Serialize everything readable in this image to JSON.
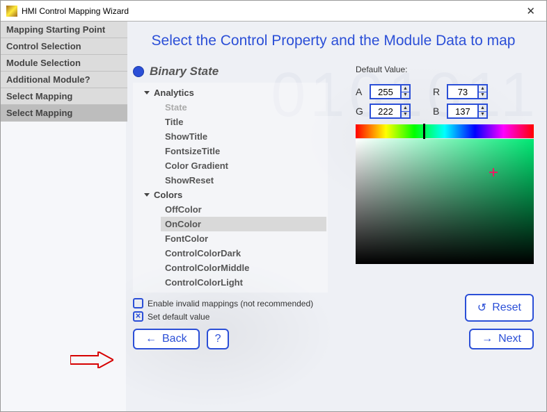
{
  "title": "HMI Control Mapping Wizard",
  "sidebar": {
    "items": [
      {
        "label": "Mapping Starting Point",
        "selected": false
      },
      {
        "label": "Control Selection",
        "selected": false
      },
      {
        "label": "Module Selection",
        "selected": false
      },
      {
        "label": "Additional Module?",
        "selected": false
      },
      {
        "label": "Select Mapping",
        "selected": false
      },
      {
        "label": "Select Mapping",
        "selected": true
      }
    ]
  },
  "heading": "Select the Control Property and the Module Data to map",
  "binary_state_label": "Binary State",
  "tree": {
    "groups": [
      {
        "label": "Analytics",
        "items": [
          {
            "label": "State",
            "dim": true
          },
          {
            "label": "Title"
          },
          {
            "label": "ShowTitle"
          },
          {
            "label": "FontsizeTitle"
          },
          {
            "label": "Color Gradient"
          },
          {
            "label": "ShowReset"
          }
        ]
      },
      {
        "label": "Colors",
        "items": [
          {
            "label": "OffColor"
          },
          {
            "label": "OnColor",
            "selected": true
          },
          {
            "label": "FontColor"
          },
          {
            "label": "ControlColorDark"
          },
          {
            "label": "ControlColorMiddle"
          },
          {
            "label": "ControlColorLight"
          }
        ]
      }
    ]
  },
  "right": {
    "default_value_label": "Default Value:",
    "argb": {
      "A": {
        "label": "A",
        "value": "255"
      },
      "R": {
        "label": "R",
        "value": "73"
      },
      "G": {
        "label": "G",
        "value": "222"
      },
      "B": {
        "label": "B",
        "value": "137"
      }
    }
  },
  "checkboxes": {
    "enable_invalid": {
      "label": "Enable invalid mappings (not recommended)",
      "checked": false
    },
    "set_default": {
      "label": "Set default value",
      "checked": true
    }
  },
  "buttons": {
    "reset": "Reset",
    "back": "Back",
    "help": "?",
    "next": "Next"
  }
}
